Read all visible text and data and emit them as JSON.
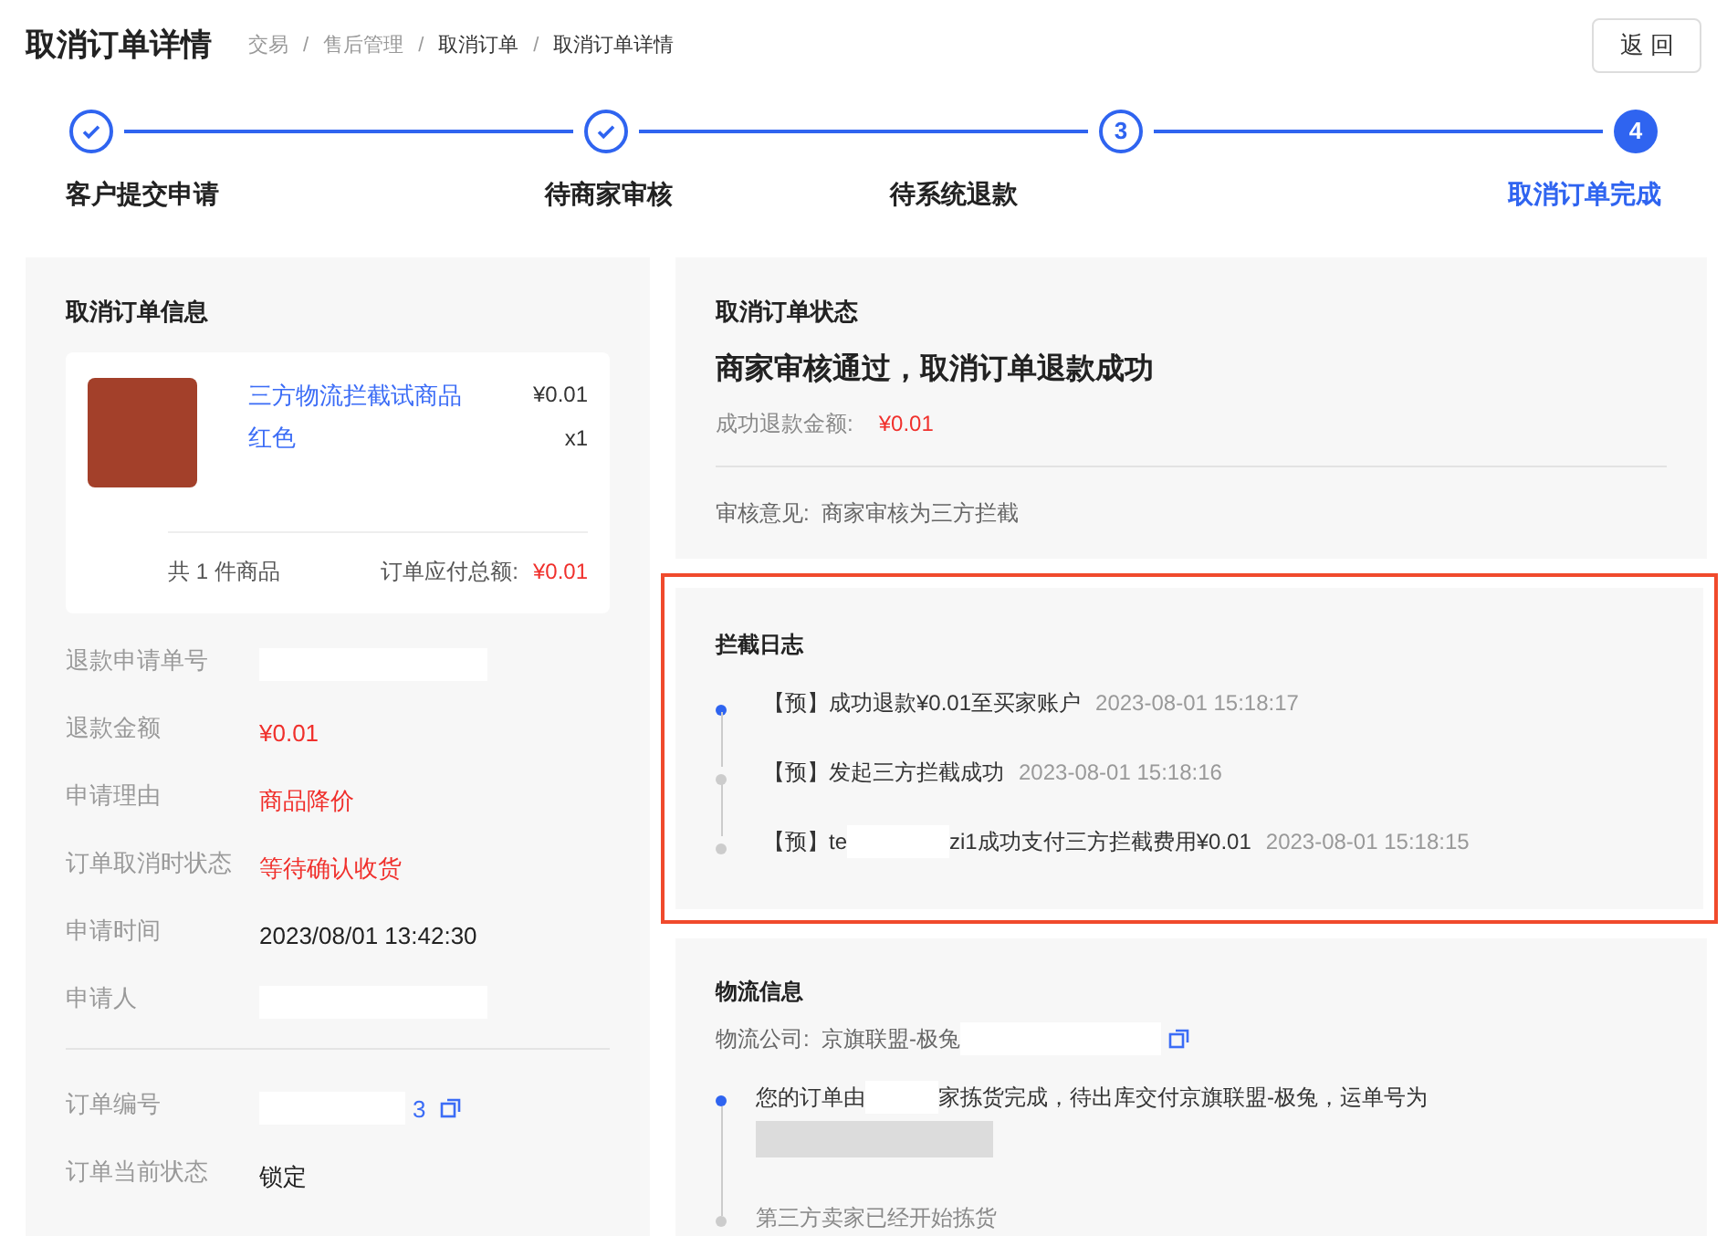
{
  "header": {
    "title": "取消订单详情",
    "separator": "/",
    "breadcrumb": [
      {
        "label": "交易",
        "current": false
      },
      {
        "label": "售后管理",
        "current": false
      },
      {
        "label": "取消订单",
        "current": true
      },
      {
        "label": "取消订单详情",
        "current": true
      }
    ],
    "back_button": "返 回"
  },
  "steps": [
    {
      "label": "客户提交申请",
      "done": true,
      "selected": false
    },
    {
      "label": "待商家审核",
      "done": true,
      "selected": false
    },
    {
      "number": "3",
      "label": "待系统退款",
      "done": false,
      "selected": false
    },
    {
      "number": "4",
      "label": "取消订单完成",
      "done": false,
      "selected": true
    }
  ],
  "order_info": {
    "title": "取消订单信息",
    "product": {
      "name": "三方物流拦截试商品",
      "variant": "红色",
      "price": "¥0.01",
      "quantity": "x1",
      "count": "共 1 件商品",
      "total_label": "订单应付总额:",
      "total": "¥0.01"
    },
    "fields": [
      {
        "label": "退款申请单号",
        "segments": [
          {
            "kind": "redacted"
          }
        ]
      },
      {
        "label": "退款金额",
        "segments": [
          {
            "kind": "text",
            "text": "¥0.01",
            "color": "#f0302c"
          }
        ]
      },
      {
        "label": "申请理由",
        "segments": [
          {
            "kind": "text",
            "text": "商品降价",
            "color": "#f0302c"
          }
        ]
      },
      {
        "label": "订单取消时状态",
        "segments": [
          {
            "kind": "text",
            "text": "等待确认收货",
            "color": "#f0302c"
          }
        ]
      },
      {
        "label": "申请时间",
        "segments": [
          {
            "kind": "text",
            "text": "2023/08/01 13:42:30",
            "color": "#222222"
          }
        ]
      },
      {
        "label": "申请人",
        "segments": [
          {
            "kind": "redacted"
          }
        ]
      }
    ],
    "order_fields": [
      {
        "label": "订单编号",
        "segments": [
          {
            "kind": "redacted"
          },
          {
            "kind": "text",
            "text": "3",
            "color": "#3b6cf6"
          },
          {
            "kind": "copy"
          }
        ]
      },
      {
        "label": "订单当前状态",
        "segments": [
          {
            "kind": "text",
            "text": "锁定",
            "color": "#222222"
          }
        ]
      }
    ]
  },
  "status": {
    "title": "取消订单状态",
    "headline": "商家审核通过，取消订单退款成功",
    "refund_label": "成功退款金额:",
    "refund_amount": "¥0.01",
    "opinion": "审核意见:  商家审核为三方拦截"
  },
  "intercept_log": {
    "title": "拦截日志",
    "entries": [
      {
        "segments": [
          {
            "kind": "text",
            "text": "【预】成功退款¥0.01至买家账户"
          }
        ],
        "time": "2023-08-01 15:18:17",
        "selected": true
      },
      {
        "segments": [
          {
            "kind": "text",
            "text": "【预】发起三方拦截成功"
          }
        ],
        "time": "2023-08-01 15:18:16",
        "selected": false
      },
      {
        "segments": [
          {
            "kind": "text",
            "text": "【预】te"
          },
          {
            "kind": "redacted"
          },
          {
            "kind": "text",
            "text": "zi1成功支付三方拦截费用¥0.01"
          }
        ],
        "time": "2023-08-01 15:18:15",
        "selected": false
      }
    ]
  },
  "logistics": {
    "title": "物流信息",
    "company": "物流公司:  京旗联盟-极兔",
    "entries": [
      {
        "segments": [
          {
            "kind": "text",
            "text": "您的订单由"
          },
          {
            "kind": "redacted"
          },
          {
            "kind": "text",
            "text": "家拣货完成，待出库交付京旗联盟-极兔，运单号为"
          }
        ],
        "extra": [
          {
            "kind": "redacted"
          }
        ],
        "selected": true
      },
      {
        "segments": [
          {
            "kind": "text",
            "text": "第三方卖家已经开始拣货"
          }
        ],
        "selected": false
      }
    ]
  }
}
